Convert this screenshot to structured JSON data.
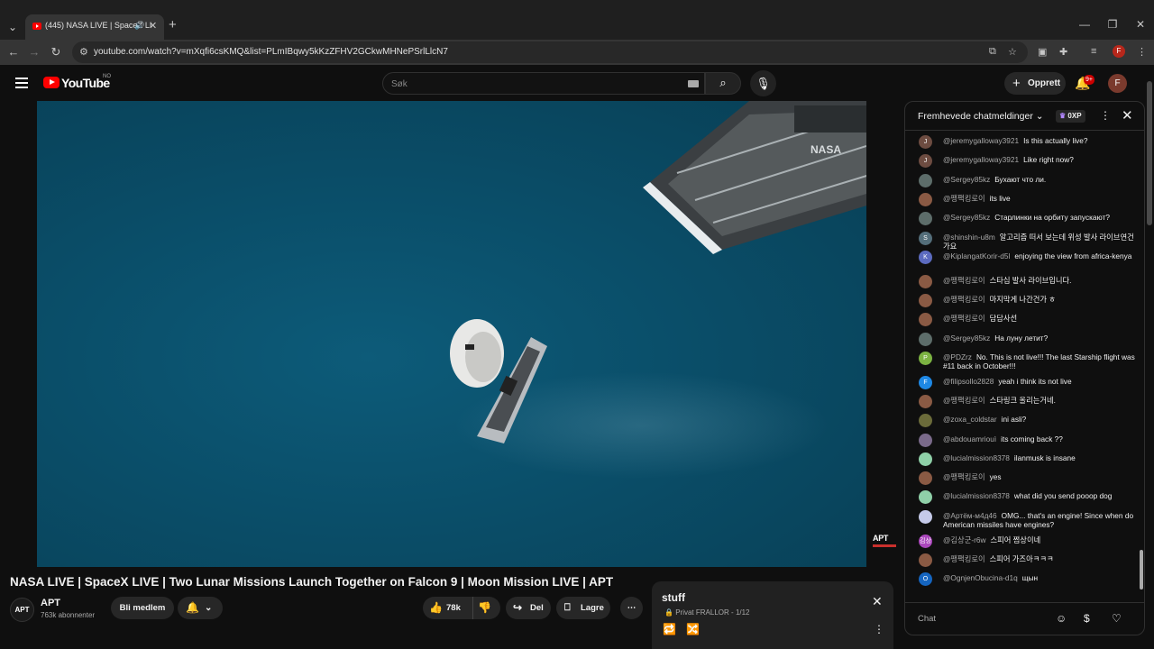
{
  "browser": {
    "tab_title": "(445) NASA LIVE | SpaceX LI",
    "tab_close": "✕",
    "new_tab": "+",
    "url": "youtube.com/watch?v=mXqfi6csKMQ&list=PLmIBqwy5kKzZFHV2GCkwMHNePSrlLlcN7",
    "profile_initial": "F"
  },
  "youtube": {
    "logo_text": "YouTube",
    "country": "NO",
    "search_placeholder": "Søk",
    "create_label": "Opprett",
    "notifications_badge": "9+",
    "avatar_initial": "F"
  },
  "video": {
    "watermark": "APT",
    "title": "NASA LIVE | SpaceX LIVE | Two Lunar Missions Launch Together on Falcon 9 | Moon Mission LIVE | APT",
    "channel_avatar": "APT",
    "channel_name": "APT",
    "subscribers": "763k abonnenter",
    "join_label": "Bli medlem",
    "like_count": "78k",
    "share_label": "Del",
    "save_label": "Lagre",
    "ship_text": "NASA"
  },
  "playlist": {
    "title": "stuff",
    "privacy": "Privat",
    "owner": "FRALLOR",
    "position": "1/12"
  },
  "chat": {
    "mode": "Fremhevede chatmeldinger",
    "xp_badge": "0XP",
    "input_placeholder": "Chat",
    "messages": [
      {
        "author": "@jeremygalloway3921",
        "text": "Is this actually live?",
        "avatar": "J",
        "color": "#6d4c41"
      },
      {
        "author": "@jeremygalloway3921",
        "text": "Like right now?",
        "avatar": "J",
        "color": "#6d4c41"
      },
      {
        "author": "@Sergey85kz",
        "text": "Бухают что ли.",
        "avatar": "",
        "color": "#5d6d6a"
      },
      {
        "author": "@팽팩킹로이",
        "text": "its live",
        "avatar": "",
        "color": "#8a5a44"
      },
      {
        "author": "@Sergey85kz",
        "text": "Старлинки на орбиту запускают?",
        "avatar": "",
        "color": "#5d6d6a"
      },
      {
        "author": "@shinshin-u8m",
        "text": "알고리즘 떠서 보는데 위성 발사 라이브연건가요",
        "avatar": "S",
        "color": "#546e7a"
      },
      {
        "author": "@KiplangatKorir-d5l",
        "text": "enjoying the view from africa-kenya",
        "avatar": "K",
        "color": "#5c6bc0"
      },
      {
        "author": "@팽팩킹로이",
        "text": "스타십 발사 라이브입니다.",
        "avatar": "",
        "color": "#8a5a44"
      },
      {
        "author": "@팽팩킹로이",
        "text": "마지막게 나간건가 ㅎ",
        "avatar": "",
        "color": "#8a5a44"
      },
      {
        "author": "@팽팩킹로이",
        "text": "담담사선",
        "avatar": "",
        "color": "#8a5a44"
      },
      {
        "author": "@Sergey85kz",
        "text": "На луну летит?",
        "avatar": "",
        "color": "#5d6d6a"
      },
      {
        "author": "@PDZrz",
        "text": "No. This is not live!!! The last Starship flight was #11 back in October!!!",
        "avatar": "P",
        "color": "#7cb342"
      },
      {
        "author": "@filipsollo2828",
        "text": "yeah i think its not live",
        "avatar": "F",
        "color": "#1e88e5"
      },
      {
        "author": "@팽팩킹로이",
        "text": "스타링크 올리는거네.",
        "avatar": "",
        "color": "#8a5a44"
      },
      {
        "author": "@zoxa_coldstar",
        "text": "ini asli?",
        "avatar": "",
        "color": "#6b6b3a"
      },
      {
        "author": "@abdouamriouì",
        "text": "its coming back ??",
        "avatar": "",
        "color": "#7a6a8a"
      },
      {
        "author": "@lucialmission8378",
        "text": "ilanmusk is insane",
        "avatar": "",
        "color": "#8fd0a8"
      },
      {
        "author": "@팽팩킹로이",
        "text": "yes",
        "avatar": "",
        "color": "#8a5a44"
      },
      {
        "author": "@lucialmission8378",
        "text": "what did you send pooop dog",
        "avatar": "",
        "color": "#8fd0a8"
      },
      {
        "author": "@Артём-м4д46",
        "text": "OMG... that's an engine! Since when do American missiles have engines?",
        "avatar": "",
        "color": "#c5cae9"
      },
      {
        "author": "@김상군-r6w",
        "text": "스피어 쩜상이네",
        "avatar": "김상",
        "color": "#ab47bc"
      },
      {
        "author": "@팽팩킹로이",
        "text": "스피어 가즈아ㅋㅋㅋ",
        "avatar": "",
        "color": "#8a5a44"
      },
      {
        "author": "@OgnjenObucina-d1q",
        "text": "щын",
        "avatar": "O",
        "color": "#1565c0"
      }
    ]
  },
  "colors": {
    "youtube_red": "#ff0000",
    "background": "#0f0f0f",
    "water": "#0a4e69"
  }
}
